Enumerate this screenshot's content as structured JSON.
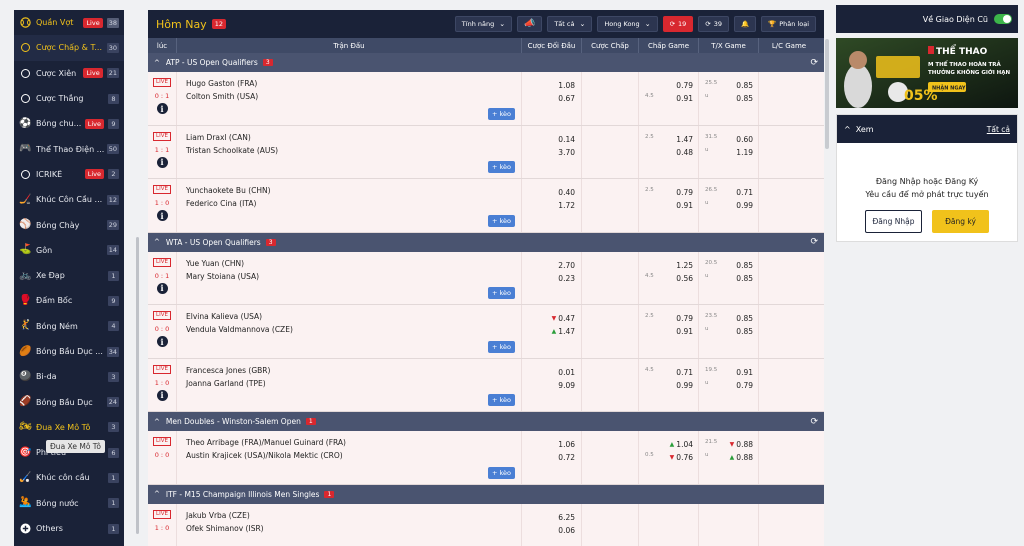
{
  "sidebar": {
    "items": [
      {
        "label": "Quần Vợt",
        "live": "Live",
        "count": "38",
        "icon": "tennis-ball-icon"
      },
      {
        "label": "Cược Chấp & T...",
        "live": "",
        "count": "30",
        "icon": "circle-icon"
      },
      {
        "label": "Cược Xiên",
        "live": "Live",
        "count": "21",
        "icon": "circle-icon"
      },
      {
        "label": "Cược Thắng",
        "live": "",
        "count": "8",
        "icon": "circle-icon"
      },
      {
        "label": "Bóng chu...",
        "live": "Live",
        "count": "9",
        "icon": "soccer-ball-icon"
      },
      {
        "label": "Thể Thao Điện ...",
        "live": "",
        "count": "50",
        "icon": "gamepad-icon"
      },
      {
        "label": "ICRIKÊ",
        "live": "Live",
        "count": "2",
        "icon": "cricket-icon"
      },
      {
        "label": "Khúc Côn Cầu ...",
        "live": "",
        "count": "12",
        "icon": "hockey-stick-icon"
      },
      {
        "label": "Bóng Chày",
        "live": "",
        "count": "29",
        "icon": "baseball-icon"
      },
      {
        "label": "Gôn",
        "live": "",
        "count": "14",
        "icon": "golf-icon"
      },
      {
        "label": "Xe Đạp",
        "live": "",
        "count": "1",
        "icon": "bicycle-icon"
      },
      {
        "label": "Đấm Bốc",
        "live": "",
        "count": "9",
        "icon": "boxing-glove-icon"
      },
      {
        "label": "Bóng Ném",
        "live": "",
        "count": "4",
        "icon": "handball-icon"
      },
      {
        "label": "Bóng Bầu Dục ...",
        "live": "",
        "count": "34",
        "icon": "rugby-ball-icon"
      },
      {
        "label": "Bi-da",
        "live": "",
        "count": "3",
        "icon": "billiards-icon"
      },
      {
        "label": "Bóng Bầu Dục",
        "live": "",
        "count": "24",
        "icon": "american-football-icon"
      },
      {
        "label": "Đua Xe Mô Tô",
        "live": "",
        "count": "3",
        "icon": "motorbike-icon"
      },
      {
        "label": "Phi tiêu",
        "live": "",
        "count": "6",
        "icon": "darts-icon"
      },
      {
        "label": "Khúc côn cầu",
        "live": "",
        "count": "1",
        "icon": "field-hockey-icon"
      },
      {
        "label": "Bóng nước",
        "live": "",
        "count": "1",
        "icon": "water-polo-icon"
      },
      {
        "label": "Others",
        "live": "",
        "count": "1",
        "icon": "plus-circle-icon"
      }
    ],
    "tooltip": "Đua Xe Mô Tô"
  },
  "topbar": {
    "title": "Hôm Nay",
    "title_count": "12",
    "features": "Tính năng",
    "all": "Tất cả",
    "odds_type": "Hong Kong",
    "live_count": "19",
    "refresh_count": "39",
    "sort": "Phân loại"
  },
  "columns": [
    "lúc",
    "Trận Đấu",
    "Cược Đối Đầu",
    "Cược Chấp",
    "Chấp Game",
    "T/X Game",
    "L/C Game"
  ],
  "leagues": [
    {
      "name": "ATP - US Open Qualifiers",
      "count": "3"
    },
    {
      "name": "WTA - US Open Qualifiers",
      "count": "3"
    },
    {
      "name": "Men Doubles - Winston-Salem Open",
      "count": "1"
    },
    {
      "name": "ITF - M15 Champaign Illinois Men Singles",
      "count": "1"
    }
  ],
  "matches": [
    {
      "live": "LIVE",
      "score": "0 : 1",
      "home": "Hugo Gaston (FRA)",
      "away": "Colton Smith (USA)",
      "o1": "1.08",
      "o2": "0.67",
      "gh_line": "4.5",
      "gh1": "0.79",
      "gh2": "0.91",
      "gou_line": "25.5",
      "gou_u": "u",
      "gou1": "0.85",
      "gou2": "0.85",
      "more": "+ kèo"
    },
    {
      "live": "LIVE",
      "score": "1 : 1",
      "home": "Liam Draxl (CAN)",
      "away": "Tristan Schoolkate (AUS)",
      "o1": "0.14",
      "o2": "3.70",
      "gh_line": "2.5",
      "gh1": "1.47",
      "gh2": "0.48",
      "gou_line": "31.5",
      "gou_u": "u",
      "gou1": "0.60",
      "gou2": "1.19",
      "more": "+ kèo"
    },
    {
      "live": "LIVE",
      "score": "1 : 0",
      "home": "Yunchaokete Bu (CHN)",
      "away": "Federico Cina (ITA)",
      "o1": "0.40",
      "o2": "1.72",
      "gh_line": "2.5",
      "gh1": "0.79",
      "gh2": "0.91",
      "gou_line": "26.5",
      "gou_u": "u",
      "gou1": "0.71",
      "gou2": "0.99",
      "more": "+ kèo"
    },
    {
      "live": "LIVE",
      "score": "0 : 1",
      "home": "Yue Yuan (CHN)",
      "away": "Mary Stoiana (USA)",
      "o1": "2.70",
      "o2": "0.23",
      "gh_line": "4.5",
      "gh1": "1.25",
      "gh2": "0.56",
      "gou_line": "20.5",
      "gou_u": "u",
      "gou1": "0.85",
      "gou2": "0.85",
      "more": "+ kèo"
    },
    {
      "live": "LIVE",
      "score": "0 : 0",
      "home": "Elvina Kalieva (USA)",
      "away": "Vendula Valdmannova (CZE)",
      "o1": "0.47",
      "o2": "1.47",
      "gh_line": "2.5",
      "gh1": "0.79",
      "gh2": "0.91",
      "gou_line": "23.5",
      "gou_u": "u",
      "gou1": "0.85",
      "gou2": "0.85",
      "more": "+ kèo"
    },
    {
      "live": "LIVE",
      "score": "1 : 0",
      "home": "Francesca Jones (GBR)",
      "away": "Joanna Garland (TPE)",
      "o1": "0.01",
      "o2": "9.09",
      "gh_line": "4.5",
      "gh1": "0.71",
      "gh2": "0.99",
      "gou_line": "19.5",
      "gou_u": "u",
      "gou1": "0.91",
      "gou2": "0.79",
      "more": "+ kèo"
    },
    {
      "live": "LIVE",
      "score": "0 : 0",
      "home": "Theo Arribage (FRA)/Manuel Guinard (FRA)",
      "away": "Austin Krajicek (USA)/Nikola Mektic (CRO)",
      "o1": "1.06",
      "o2": "0.72",
      "gh_line": "0.5",
      "gh1": "1.04",
      "gh2": "0.76",
      "gou_line": "21.5",
      "gou_u": "u",
      "gou1": "0.88",
      "gou2": "0.88",
      "more": "+ kèo"
    },
    {
      "live": "LIVE",
      "score": "1 : 0",
      "home": "Jakub Vrba (CZE)",
      "away": "Ofek Shimanov (ISR)",
      "o1": "6.25",
      "o2": "0.06",
      "gh_line": "",
      "gh1": "",
      "gh2": "",
      "gou_line": "",
      "gou_u": "",
      "gou1": "",
      "gou2": "",
      "more": ""
    }
  ],
  "right": {
    "toggle_label": "Về Giao Diện Cũ",
    "banner": {
      "brand": "THỂ THAO",
      "line1": "M THỂ THAO HOÀN TRẢ",
      "line2": "THƯỞNG KHÔNG GIỚI HẠN",
      "cta": "NHẬN NGAY!",
      "badge": "05%"
    },
    "panel_title": "Xem",
    "panel_all": "Tất cả",
    "prompt1": "Đăng Nhập hoặc Đăng Ký",
    "prompt2": "Yêu cầu để mở phát trực tuyến",
    "login": "Đăng Nhập",
    "register": "Đăng ký"
  },
  "colors": {
    "navy": "#1a2238",
    "accent": "#f1c21b",
    "live_red": "#d8282f",
    "plus_blue": "#4a7fd4"
  }
}
